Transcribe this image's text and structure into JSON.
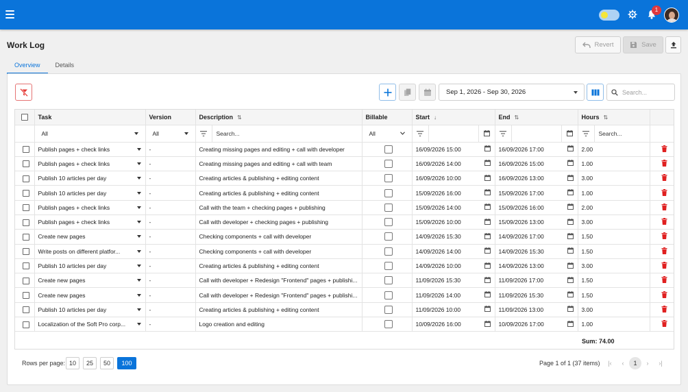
{
  "topbar": {
    "notification_count": "1"
  },
  "page": {
    "title": "Work Log",
    "revert_label": "Revert",
    "save_label": "Save"
  },
  "tabs": [
    {
      "label": "Overview",
      "active": true
    },
    {
      "label": "Details",
      "active": false
    }
  ],
  "toolbar": {
    "date_range": "Sep 1, 2026 - Sep 30, 2026",
    "search_placeholder": "Search..."
  },
  "columns": {
    "task": "Task",
    "version": "Version",
    "description": "Description",
    "billable": "Billable",
    "start": "Start",
    "end": "End",
    "hours": "Hours"
  },
  "filters": {
    "task": "All",
    "version": "All",
    "billable": "All",
    "description_placeholder": "Search...",
    "hours_placeholder": "Search..."
  },
  "rows": [
    {
      "task": "Publish pages + check links",
      "version": "-",
      "description": "Creating missing pages and editing + call with developer",
      "start": "16/09/2026 15:00",
      "end": "16/09/2026 17:00",
      "hours": "2.00"
    },
    {
      "task": "Publish pages + check links",
      "version": "-",
      "description": "Creating missing pages and editing + call with team",
      "start": "16/09/2026 14:00",
      "end": "16/09/2026 15:00",
      "hours": "1.00"
    },
    {
      "task": "Publish 10 articles per day",
      "version": "-",
      "description": "Creating articles & publishing + editing content",
      "start": "16/09/2026 10:00",
      "end": "16/09/2026 13:00",
      "hours": "3.00"
    },
    {
      "task": "Publish 10 articles per day",
      "version": "-",
      "description": "Creating articles & publishing + editing content",
      "start": "15/09/2026 16:00",
      "end": "15/09/2026 17:00",
      "hours": "1.00"
    },
    {
      "task": "Publish pages + check links",
      "version": "-",
      "description": " Call with the team + checking pages + publishing",
      "start": "15/09/2026 14:00",
      "end": "15/09/2026 16:00",
      "hours": "2.00"
    },
    {
      "task": "Publish pages + check links",
      "version": "-",
      "description": " Call with developer + checking pages + publishing",
      "start": "15/09/2026 10:00",
      "end": "15/09/2026 13:00",
      "hours": "3.00"
    },
    {
      "task": "Create new pages",
      "version": "-",
      "description": "Checking components + call with developer",
      "start": "14/09/2026 15:30",
      "end": "14/09/2026 17:00",
      "hours": "1.50"
    },
    {
      "task": "Write posts on different platfor...",
      "version": "-",
      "description": "Checking components + call with developer",
      "start": "14/09/2026 14:00",
      "end": "14/09/2026 15:30",
      "hours": "1.50"
    },
    {
      "task": "Publish 10 articles per day",
      "version": "-",
      "description": "Creating articles & publishing + editing content",
      "start": "14/09/2026 10:00",
      "end": "14/09/2026 13:00",
      "hours": "3.00"
    },
    {
      "task": "Create new pages",
      "version": "-",
      "description": "Call with developer + Redesign \"Frontend\" pages + publishi...",
      "start": "11/09/2026 15:30",
      "end": "11/09/2026 17:00",
      "hours": "1.50"
    },
    {
      "task": "Create new pages",
      "version": "-",
      "description": "Call with developer + Redesign \"Frontend\" pages + publishi...",
      "start": "11/09/2026 14:00",
      "end": "11/09/2026 15:30",
      "hours": "1.50"
    },
    {
      "task": "Publish 10 articles per day",
      "version": "-",
      "description": "Creating articles & publishing + editing content",
      "start": "11/09/2026 10:00",
      "end": "11/09/2026 13:00",
      "hours": "3.00"
    },
    {
      "task": "Localization of the Soft Pro corp...",
      "version": "-",
      "description": "Logo creation and editing",
      "start": "10/09/2026 16:00",
      "end": "10/09/2026 17:00",
      "hours": "1.00"
    }
  ],
  "summary": {
    "sum_label": "Sum: 74.00"
  },
  "pagination": {
    "rows_per_page_label": "Rows per page:",
    "options": [
      "10",
      "25",
      "50",
      "100"
    ],
    "selected": "100",
    "page_info": "Page 1 of 1 (37 items)",
    "current_page": "1"
  },
  "colors": {
    "primary": "#0a74da",
    "delete": "#e02020",
    "badge": "#e0383e"
  }
}
